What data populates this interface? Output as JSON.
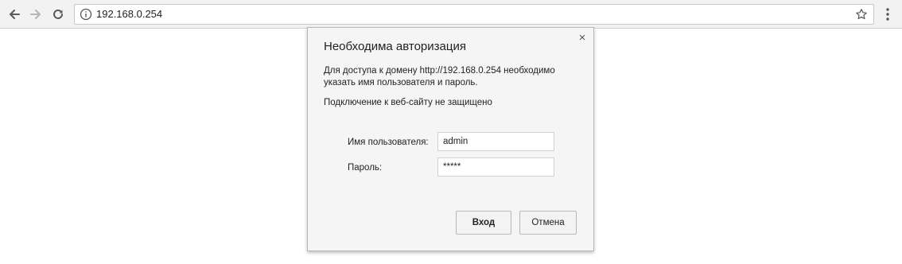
{
  "browser": {
    "address_bar": {
      "url": "192.168.0.254"
    },
    "icons": {
      "back": "back-arrow-icon",
      "forward": "forward-arrow-icon",
      "reload": "reload-icon",
      "info": "info-icon",
      "bookmark": "star-icon",
      "menu": "vertical-dots-menu-icon"
    }
  },
  "auth_dialog": {
    "title": "Необходима авторизация",
    "close_glyph": "×",
    "message_line1": "Для доступа к домену http://192.168.0.254 необходимо",
    "message_line2": "указать имя пользователя и пароль.",
    "connection_warning": "Подключение к веб-сайту не защищено",
    "username_label": "Имя пользователя:",
    "username_value": "admin",
    "password_label": "Пароль:",
    "password_value": "*****",
    "login_button": "Вход",
    "cancel_button": "Отмена"
  },
  "colors": {
    "toolbar_bg": "#f2f2f2",
    "dialog_bg": "#f5f5f5",
    "page_bg": "#ffffff"
  }
}
